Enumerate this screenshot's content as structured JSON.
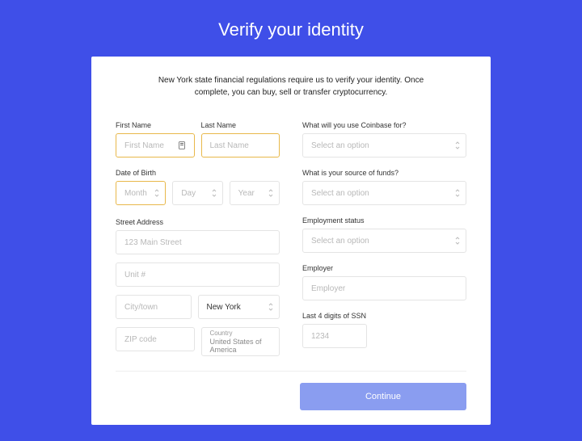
{
  "colors": {
    "page_bg": "#3f4fe8",
    "highlight_border": "#e8b84a",
    "button_bg": "#8a9df0"
  },
  "page": {
    "title": "Verify your identity"
  },
  "intro": "New York state financial regulations require us to verify your identity. Once complete, you can buy, sell or transfer cryptocurrency.",
  "left": {
    "first_name": {
      "label": "First Name",
      "placeholder": "First Name",
      "value": ""
    },
    "last_name": {
      "label": "Last Name",
      "placeholder": "Last Name",
      "value": ""
    },
    "dob": {
      "label": "Date of Birth",
      "month": {
        "placeholder": "Month",
        "value": ""
      },
      "day": {
        "placeholder": "Day",
        "value": ""
      },
      "year": {
        "placeholder": "Year",
        "value": ""
      }
    },
    "address": {
      "label": "Street Address",
      "street": {
        "placeholder": "123 Main Street",
        "value": ""
      },
      "unit": {
        "placeholder": "Unit #",
        "value": ""
      },
      "city": {
        "placeholder": "City/town",
        "value": ""
      },
      "state": {
        "value": "New York"
      },
      "zip": {
        "placeholder": "ZIP code",
        "value": ""
      },
      "country": {
        "label": "Country",
        "value": "United States of America"
      }
    }
  },
  "right": {
    "use_for": {
      "label": "What will you use Coinbase for?",
      "placeholder": "Select an option",
      "value": ""
    },
    "source_of_funds": {
      "label": "What is your source of funds?",
      "placeholder": "Select an option",
      "value": ""
    },
    "employment_status": {
      "label": "Employment status",
      "placeholder": "Select an option",
      "value": ""
    },
    "employer": {
      "label": "Employer",
      "placeholder": "Employer",
      "value": ""
    },
    "ssn": {
      "label": "Last 4 digits of SSN",
      "placeholder": "1234",
      "value": ""
    }
  },
  "actions": {
    "continue": "Continue"
  }
}
